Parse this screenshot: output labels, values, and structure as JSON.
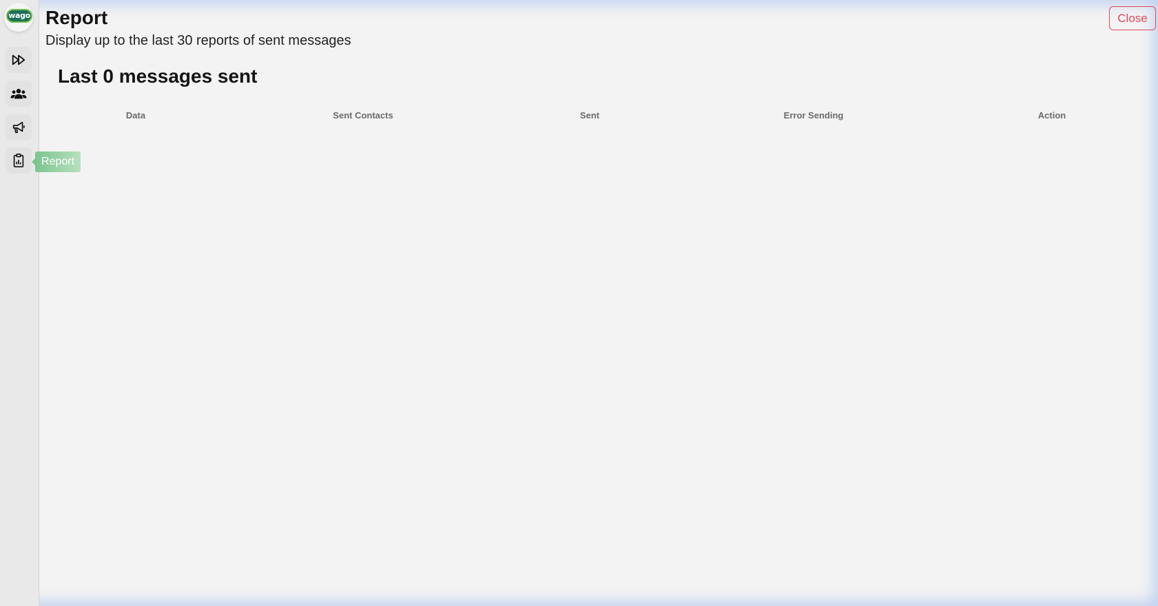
{
  "app": {
    "logo_text": "wago"
  },
  "sidebar": {
    "items": [
      {
        "name": "forward",
        "icon": "fast-forward-icon"
      },
      {
        "name": "contacts",
        "icon": "users-icon"
      },
      {
        "name": "campaigns",
        "icon": "megaphone-icon"
      },
      {
        "name": "report",
        "icon": "clipboard-report-icon"
      }
    ],
    "tooltip": "Report"
  },
  "header": {
    "title": "Report",
    "subtitle": "Display up to the last 30 reports of sent messages",
    "close_label": "Close"
  },
  "main": {
    "section_title": "Last 0 messages sent",
    "table": {
      "columns": [
        "Data",
        "Sent Contacts",
        "Sent",
        "Error Sending",
        "Action"
      ],
      "rows": []
    }
  },
  "colors": {
    "background": "#f3f3f3",
    "close_accent": "#e0475a",
    "tooltip_green": "#7cc48e",
    "logo_green": "#1f6f5a"
  }
}
